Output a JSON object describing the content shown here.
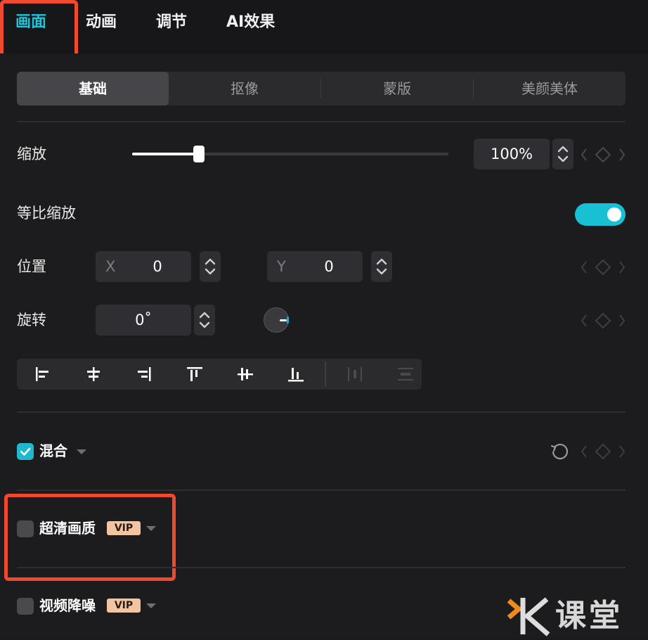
{
  "top_tabs": [
    {
      "label": "画面",
      "active": true
    },
    {
      "label": "动画",
      "active": false
    },
    {
      "label": "调节",
      "active": false
    },
    {
      "label": "AI效果",
      "active": false
    }
  ],
  "sub_tabs": [
    {
      "label": "基础",
      "active": true
    },
    {
      "label": "抠像",
      "active": false
    },
    {
      "label": "蒙版",
      "active": false
    },
    {
      "label": "美颜美体",
      "active": false
    }
  ],
  "scale": {
    "label": "缩放",
    "value": "100%",
    "slider_fraction": 0.21
  },
  "uniform_scale": {
    "label": "等比缩放",
    "enabled": true
  },
  "position": {
    "label": "位置",
    "x_prefix": "X",
    "x_value": "0",
    "y_prefix": "Y",
    "y_value": "0"
  },
  "rotation": {
    "label": "旋转",
    "value": "0˚"
  },
  "align_icons": [
    "align-left-icon",
    "align-center-h-icon",
    "align-right-icon",
    "align-top-icon",
    "align-center-v-icon",
    "align-bottom-icon",
    "distribute-h-icon",
    "distribute-v-icon"
  ],
  "blend": {
    "label": "混合",
    "checked": true
  },
  "hd_quality": {
    "label": "超清画质",
    "checked": false,
    "badge": "VIP"
  },
  "denoise": {
    "label": "视频降噪",
    "checked": false,
    "badge": "VIP"
  },
  "watermark": {
    "text": "课堂"
  },
  "colors": {
    "accent": "#20c4d6",
    "highlight_box": "#ef4a2e",
    "vip": "#f2c4a2"
  }
}
